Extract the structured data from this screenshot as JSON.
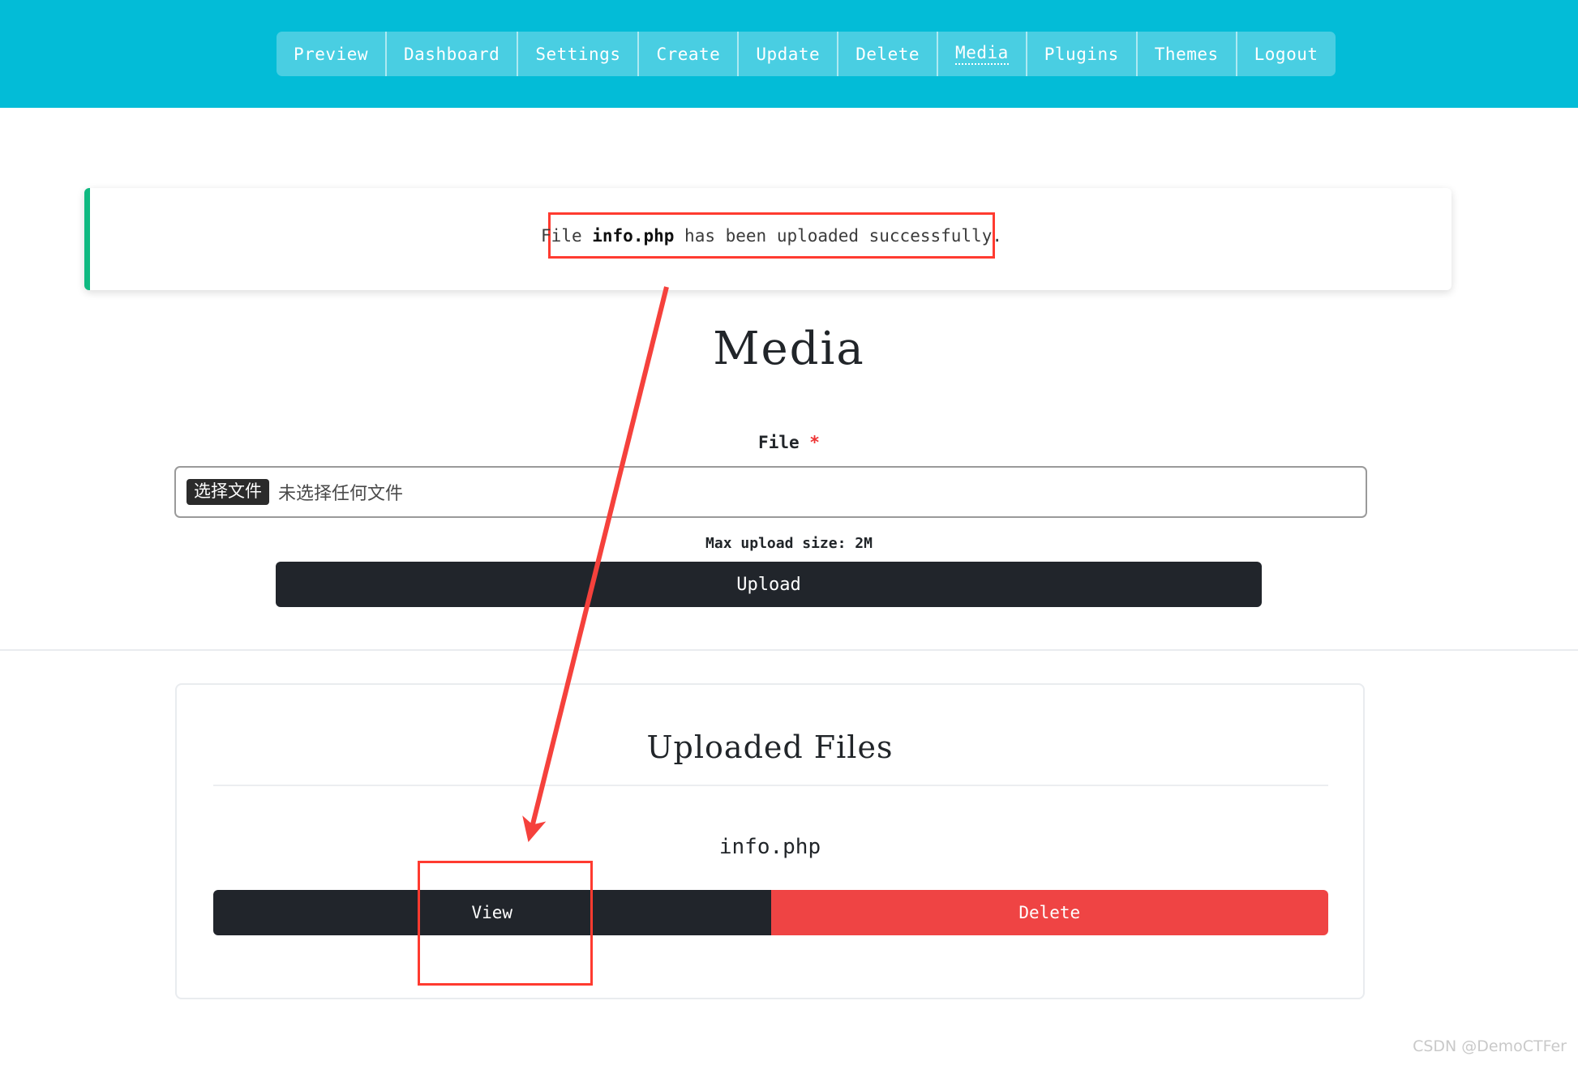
{
  "navbar": {
    "background_color": "#03bcd7",
    "items": [
      {
        "label": "Preview",
        "active": false
      },
      {
        "label": "Dashboard",
        "active": false
      },
      {
        "label": "Settings",
        "active": false
      },
      {
        "label": "Create",
        "active": false
      },
      {
        "label": "Update",
        "active": false
      },
      {
        "label": "Delete",
        "active": false
      },
      {
        "label": "Media",
        "active": true
      },
      {
        "label": "Plugins",
        "active": false
      },
      {
        "label": "Themes",
        "active": false
      },
      {
        "label": "Logout",
        "active": false
      }
    ]
  },
  "alert": {
    "accent_color": "#10b981",
    "prefix": "File ",
    "filename": "info.php",
    "suffix": " has been uploaded successfully."
  },
  "main": {
    "title": "Media",
    "file_label": "File",
    "required_marker": "*",
    "file_input": {
      "button_label": "选择文件",
      "status_text": "未选择任何文件"
    },
    "max_upload_size": "Max upload size: 2M",
    "upload_button": "Upload"
  },
  "uploaded_files": {
    "title": "Uploaded Files",
    "files": [
      {
        "name": "info.php",
        "view_label": "View",
        "delete_label": "Delete"
      }
    ],
    "view_color": "#21252b",
    "delete_color": "#ef4444"
  },
  "annotations": {
    "highlight_color": "#ff3b30",
    "arrow_from": "alert message",
    "arrow_to": "View button"
  },
  "watermark": {
    "text": "CSDN @DemoCTFer"
  }
}
